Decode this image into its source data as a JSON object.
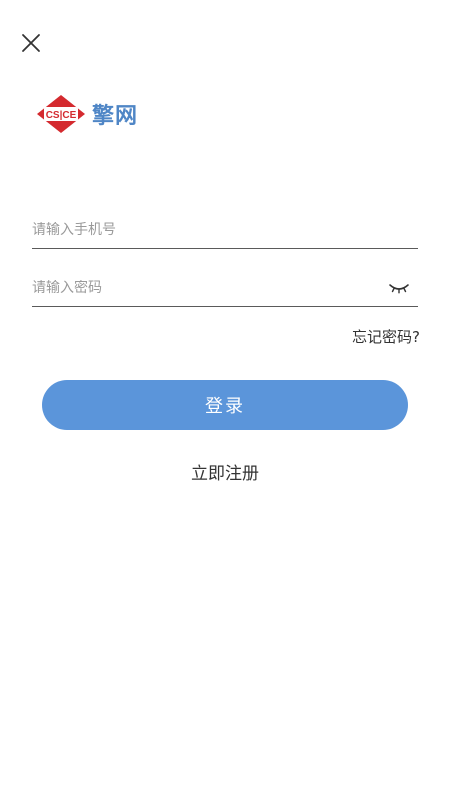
{
  "header": {
    "close_icon": "close-icon"
  },
  "brand": {
    "logo_icon": "csice-emblem-icon",
    "logo_text": "CS|CE",
    "name": "擎网",
    "color": "#4f86c6"
  },
  "form": {
    "phone": {
      "value": "",
      "placeholder": "请输入手机号"
    },
    "password": {
      "value": "",
      "placeholder": "请输入密码",
      "toggle_icon": "eye-closed-icon"
    },
    "forgot_label": "忘记密码?",
    "login_label": "登录",
    "register_label": "立即注册"
  },
  "colors": {
    "primary": "#5b95da",
    "logo_red": "#d42a2f",
    "text": "#333333",
    "placeholder": "#9a9a9a"
  }
}
